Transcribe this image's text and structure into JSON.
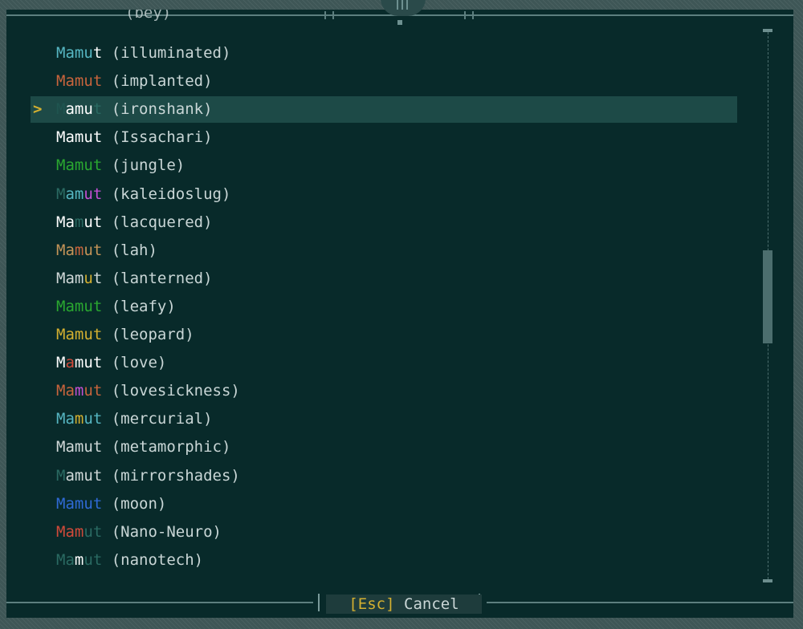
{
  "list": {
    "partial_top_text": "(bey)",
    "items": [
      {
        "letters": [
          "M",
          "a",
          "m",
          "u",
          "t"
        ],
        "colors": [
          "#56b6c2",
          "#56b6c2",
          "#56b6c2",
          "#56b6c2",
          "#ffffff"
        ],
        "variant": "(illuminated)",
        "selected": false
      },
      {
        "letters": [
          "M",
          "a",
          "m",
          "u",
          "t"
        ],
        "colors": [
          "#c8643c",
          "#c8643c",
          "#c8643c",
          "#c8643c",
          "#c8643c"
        ],
        "variant": "(implanted)",
        "selected": false
      },
      {
        "letters": [
          "M",
          "a",
          "m",
          "u",
          "t"
        ],
        "colors": [
          "#1f5550",
          "#ffffff",
          "#ffffff",
          "#ffffff",
          "#2a6a62"
        ],
        "variant": "(ironshank)",
        "selected": true
      },
      {
        "letters": [
          "M",
          "a",
          "m",
          "u",
          "t"
        ],
        "colors": [
          "#ffffff",
          "#ffffff",
          "#ffffff",
          "#ffffff",
          "#ffffff"
        ],
        "variant": "(Issachari)",
        "selected": false
      },
      {
        "letters": [
          "M",
          "a",
          "m",
          "u",
          "t"
        ],
        "colors": [
          "#2aa830",
          "#2aa830",
          "#2aa830",
          "#2aa830",
          "#2aa830"
        ],
        "variant": "(jungle)",
        "selected": false
      },
      {
        "letters": [
          "M",
          "a",
          "m",
          "u",
          "t"
        ],
        "colors": [
          "#2a6a62",
          "#56b6c2",
          "#56b6c2",
          "#c64fd6",
          "#c64fd6"
        ],
        "variant": "(kaleidoslug)",
        "selected": false
      },
      {
        "letters": [
          "M",
          "a",
          "m",
          "u",
          "t"
        ],
        "colors": [
          "#ffffff",
          "#ffffff",
          "#2a6a62",
          "#ffffff",
          "#ffffff"
        ],
        "variant": "(lacquered)",
        "selected": false
      },
      {
        "letters": [
          "M",
          "a",
          "m",
          "u",
          "t"
        ],
        "colors": [
          "#c49458",
          "#c49458",
          "#c8643c",
          "#c49458",
          "#c49458"
        ],
        "variant": "(lah)",
        "selected": false
      },
      {
        "letters": [
          "M",
          "a",
          "m",
          "u",
          "t"
        ],
        "colors": [
          "#d0d8d8",
          "#d0d8d8",
          "#d0d8d8",
          "#d4b030",
          "#d0d8d8"
        ],
        "variant": "(lanterned)",
        "selected": false
      },
      {
        "letters": [
          "M",
          "a",
          "m",
          "u",
          "t"
        ],
        "colors": [
          "#2aa830",
          "#2aa830",
          "#2aa830",
          "#2aa830",
          "#2aa830"
        ],
        "variant": "(leafy)",
        "selected": false
      },
      {
        "letters": [
          "M",
          "a",
          "m",
          "u",
          "t"
        ],
        "colors": [
          "#d4b030",
          "#d4b030",
          "#d4b030",
          "#d4b030",
          "#d4b030"
        ],
        "variant": "(leopard)",
        "selected": false
      },
      {
        "letters": [
          "M",
          "a",
          "m",
          "u",
          "t"
        ],
        "colors": [
          "#ffffff",
          "#d04a3a",
          "#ffffff",
          "#ffffff",
          "#ffffff"
        ],
        "variant": "(love)",
        "selected": false
      },
      {
        "letters": [
          "M",
          "a",
          "m",
          "u",
          "t"
        ],
        "colors": [
          "#c8643c",
          "#c8643c",
          "#c64fd6",
          "#c8643c",
          "#c8643c"
        ],
        "variant": "(lovesickness)",
        "selected": false
      },
      {
        "letters": [
          "M",
          "a",
          "m",
          "u",
          "t"
        ],
        "colors": [
          "#56b6c2",
          "#56b6c2",
          "#d4b030",
          "#56b6c2",
          "#56b6c2"
        ],
        "variant": "(mercurial)",
        "selected": false
      },
      {
        "letters": [
          "M",
          "a",
          "m",
          "u",
          "t"
        ],
        "colors": [
          "#d0d8d8",
          "#d0d8d8",
          "#d0d8d8",
          "#d0d8d8",
          "#d0d8d8"
        ],
        "variant": "(metamorphic)",
        "selected": false
      },
      {
        "letters": [
          "M",
          "a",
          "m",
          "u",
          "t"
        ],
        "colors": [
          "#2a6a62",
          "#d0d8d8",
          "#d0d8d8",
          "#d0d8d8",
          "#d0d8d8"
        ],
        "variant": "(mirrorshades)",
        "selected": false
      },
      {
        "letters": [
          "M",
          "a",
          "m",
          "u",
          "t"
        ],
        "colors": [
          "#2f6ad6",
          "#2f6ad6",
          "#2f6ad6",
          "#2f6ad6",
          "#2f6ad6"
        ],
        "variant": "(moon)",
        "selected": false
      },
      {
        "letters": [
          "M",
          "a",
          "m",
          "u",
          "t"
        ],
        "colors": [
          "#d04a3a",
          "#d04a3a",
          "#d04a3a",
          "#2a6a62",
          "#2a6a62"
        ],
        "variant": "(Nano-Neuro)",
        "selected": false
      },
      {
        "letters": [
          "M",
          "a",
          "m",
          "u",
          "t"
        ],
        "colors": [
          "#2a6a62",
          "#2a6a62",
          "#ffffff",
          "#2a6a62",
          "#2a6a62"
        ],
        "variant": "(nanotech)",
        "selected": false
      }
    ]
  },
  "selection_marker": ">",
  "footer": {
    "key_label": "[Esc]",
    "cancel_label": "Cancel"
  },
  "scroll": {
    "position_fraction": 0.42
  }
}
